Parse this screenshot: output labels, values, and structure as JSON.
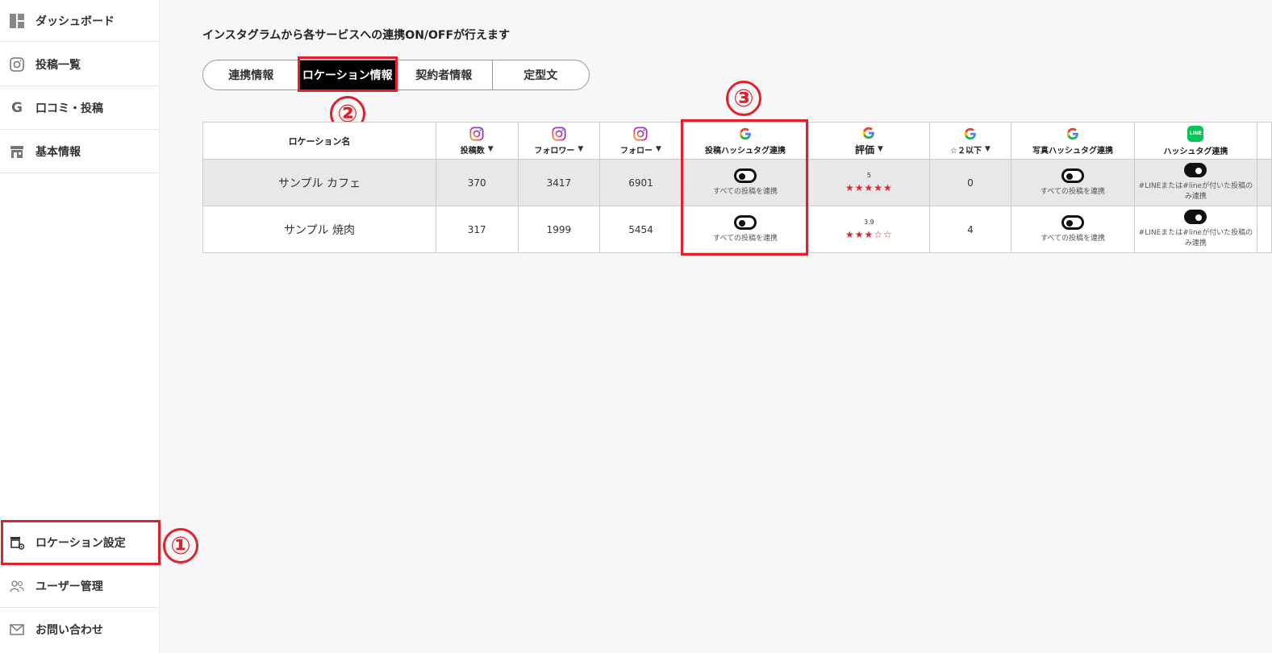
{
  "sidebar": {
    "items": [
      {
        "label": "ダッシュボード",
        "icon": "dashboard-icon"
      },
      {
        "label": "投稿一覧",
        "icon": "instagram-icon"
      },
      {
        "label": "口コミ・投稿",
        "icon": "google-icon"
      },
      {
        "label": "基本情報",
        "icon": "store-icon"
      },
      {
        "label": "ロケーション設定",
        "icon": "location-settings-icon"
      },
      {
        "label": "ユーザー管理",
        "icon": "users-icon"
      },
      {
        "label": "お問い合わせ",
        "icon": "mail-icon"
      }
    ]
  },
  "callouts": [
    "①",
    "②",
    "③"
  ],
  "main": {
    "description": "インスタグラムから各サービスへの連携ON/OFFが行えます",
    "tabs": [
      "連携情報",
      "ロケーション情報",
      "契約者情報",
      "定型文"
    ],
    "active_tab": "ロケーション情報"
  },
  "table": {
    "headers": {
      "name": "ロケーション名",
      "posts": "投稿数",
      "followers": "フォロワー",
      "following": "フォロー",
      "post_hashtag": "投稿ハッシュタグ連携",
      "rating": "評価",
      "low_rating": "☆２以下",
      "photo_hashtag": "写真ハッシュタグ連携",
      "line_hashtag": "ハッシュタグ連携",
      "line_icon_text": "LINE"
    },
    "rows": [
      {
        "name": "サンプル カフェ",
        "posts": "370",
        "followers": "3417",
        "following": "6901",
        "post_hashtag_text": "すべての投稿を連携",
        "rating_value": "5",
        "stars": "★★★★★",
        "low_rating": "0",
        "photo_hashtag_text": "すべての投稿を連携",
        "line_text": "#LINEまたは#lineが付いた投稿のみ連携"
      },
      {
        "name": "サンプル 焼肉",
        "posts": "317",
        "followers": "1999",
        "following": "5454",
        "post_hashtag_text": "すべての投稿を連携",
        "rating_value": "3.9",
        "stars": "★★★☆☆",
        "low_rating": "4",
        "photo_hashtag_text": "すべての投稿を連携",
        "line_text": "#LINEまたは#lineが付いた投稿のみ連携"
      }
    ]
  },
  "colors": {
    "accent_red": "#e0202a",
    "star_red": "#d8272e",
    "line_green": "#06c755",
    "active_tab_bg": "#000000"
  }
}
